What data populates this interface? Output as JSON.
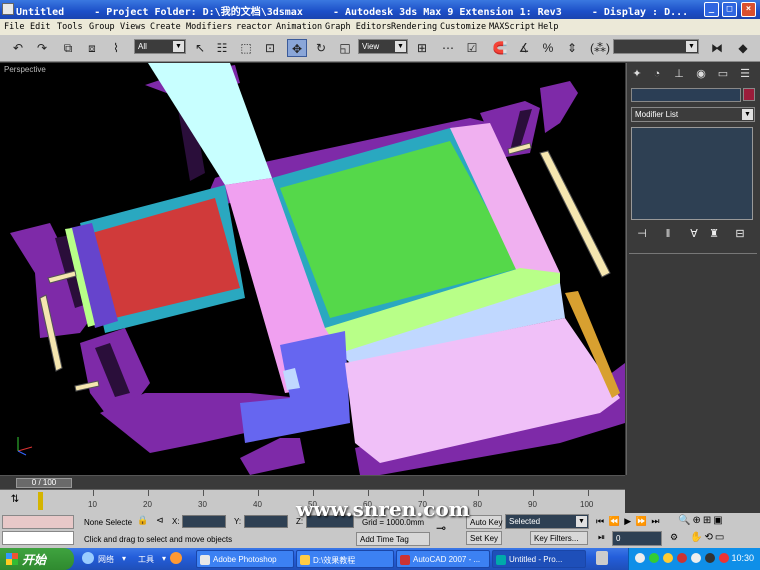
{
  "window": {
    "title": "Untitled     - Project Folder: D:\\我的文档\\3dsmax     - Autodesk 3ds Max 9 Extension 1: Rev3     - Display : D...",
    "min_icon": "minimize-icon",
    "max_icon": "maximize-icon",
    "close_icon": "close-icon"
  },
  "menu": [
    "File",
    "Edit",
    "Tools",
    "Group",
    "Views",
    "Create",
    "Modifiers",
    "reactor",
    "Animation",
    "Graph Editors",
    "Rendering",
    "Customize",
    "MAXScript",
    "Help"
  ],
  "toolbar": {
    "selection_filter": "All",
    "ref_coord": "View",
    "named_selection": "",
    "icons": [
      "undo-icon",
      "redo-icon",
      "select-link-icon",
      "unlink-icon",
      "bind-space-warp-icon",
      "select-icon",
      "select-by-name-icon",
      "rect-region-icon",
      "window-crossing-icon",
      "move-icon",
      "rotate-icon",
      "scale-icon",
      "pivot-icon",
      "select-manipulate-icon",
      "keyboard-shortcut-icon",
      "snap-icon",
      "angle-snap-icon",
      "percent-snap-icon",
      "spinner-snap-icon",
      "mirror-icon",
      "align-icon"
    ]
  },
  "viewport": {
    "label": "Perspective"
  },
  "command_panel": {
    "tabs": [
      "create-tab-icon",
      "modify-tab-icon",
      "hierarchy-tab-icon",
      "motion-tab-icon",
      "display-tab-icon",
      "utilities-tab-icon"
    ],
    "object_name": "",
    "object_color": "#9b1c3a",
    "modifier_list": "Modifier List",
    "stack_buttons": [
      "pin-stack-icon",
      "show-end-result-icon",
      "make-unique-icon",
      "remove-modifier-icon",
      "configure-modifier-sets-icon"
    ]
  },
  "timeline": {
    "slider_label": "0 / 100",
    "ticks": [
      "10",
      "20",
      "30",
      "40",
      "50",
      "60",
      "70",
      "80",
      "90",
      "100"
    ]
  },
  "status": {
    "selection": "None Selecte",
    "x_label": "X:",
    "y_label": "Y:",
    "z_label": "Z:",
    "grid": "Grid = 1000.0mm",
    "prompt": "Click and drag to select and move objects",
    "add_time_tag": "Add Time Tag",
    "auto_key": "Auto Key",
    "set_key": "Set Key",
    "key_mode": "Selected",
    "key_filters": "Key Filters...",
    "frame": "0"
  },
  "watermark": "www.snren.com",
  "taskbar": {
    "start": "开始",
    "toolbar_items": [
      "网络",
      "工具"
    ],
    "tasks": [
      {
        "label": "Adobe Photoshop",
        "active": false
      },
      {
        "label": "D:\\效果教程",
        "active": false
      },
      {
        "label": "AutoCAD 2007 - ...",
        "active": false
      },
      {
        "label": "Untitled     - Pro...",
        "active": true
      }
    ],
    "clock": "10:30"
  },
  "colors": {
    "wall": "#7e2aa8",
    "floor_cyan": "#c8ffff",
    "floor_pink": "#f0a0f0",
    "floor_green": "#55d84a",
    "floor_red": "#d03a3a",
    "floor_blue": "#6666f0",
    "floor_teal": "#2aa8c0"
  }
}
